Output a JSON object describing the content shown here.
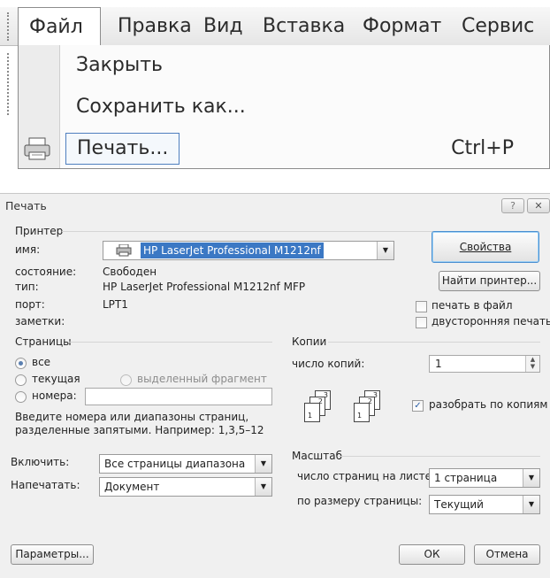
{
  "menu": {
    "items": [
      "Файл",
      "Правка",
      "Вид",
      "Вставка",
      "Формат",
      "Сервис"
    ],
    "dropdown": {
      "close": "Закрыть",
      "save_as": "Сохранить как...",
      "print": "Печать...",
      "print_shortcut": "Ctrl+P"
    }
  },
  "dialog": {
    "title": "Печать",
    "help_btn": "?",
    "close_btn": "✕",
    "printer": {
      "group": "Принтер",
      "name_label": "имя:",
      "name_value": "HP LaserJet Professional M1212nf",
      "status_label": "состояние:",
      "status_value": "Свободен",
      "type_label": "тип:",
      "type_value": "HP LaserJet Professional M1212nf MFP",
      "port_label": "порт:",
      "port_value": "LPT1",
      "notes_label": "заметки:",
      "properties_btn": "Свойства",
      "find_printer_btn": "Найти принтер...",
      "print_to_file": "печать в файл",
      "duplex": "двусторонняя печать"
    },
    "pages": {
      "group": "Страницы",
      "all": "все",
      "current": "текущая",
      "selection": "выделенный фрагмент",
      "numbers": "номера:",
      "hint_line1": "Введите номера или диапазоны страниц,",
      "hint_line2": "разделенные запятыми. Например: 1,3,5–12"
    },
    "copies": {
      "group": "Копии",
      "count_label": "число копий:",
      "count_value": "1",
      "collate": "разобрать по копиям",
      "collate_checked": true,
      "page_numbers": [
        "1",
        "2",
        "3"
      ]
    },
    "include": {
      "label": "Включить:",
      "value": "Все страницы диапазона"
    },
    "print_what": {
      "label": "Напечатать:",
      "value": "Документ"
    },
    "zoom": {
      "group": "Масштаб",
      "pages_per_sheet_label": "число страниц на листе:",
      "pages_per_sheet_value": "1 страница",
      "scale_label": "по размеру страницы:",
      "scale_value": "Текущий"
    },
    "buttons": {
      "options": "Параметры...",
      "ok": "ОК",
      "cancel": "Отмена"
    }
  }
}
